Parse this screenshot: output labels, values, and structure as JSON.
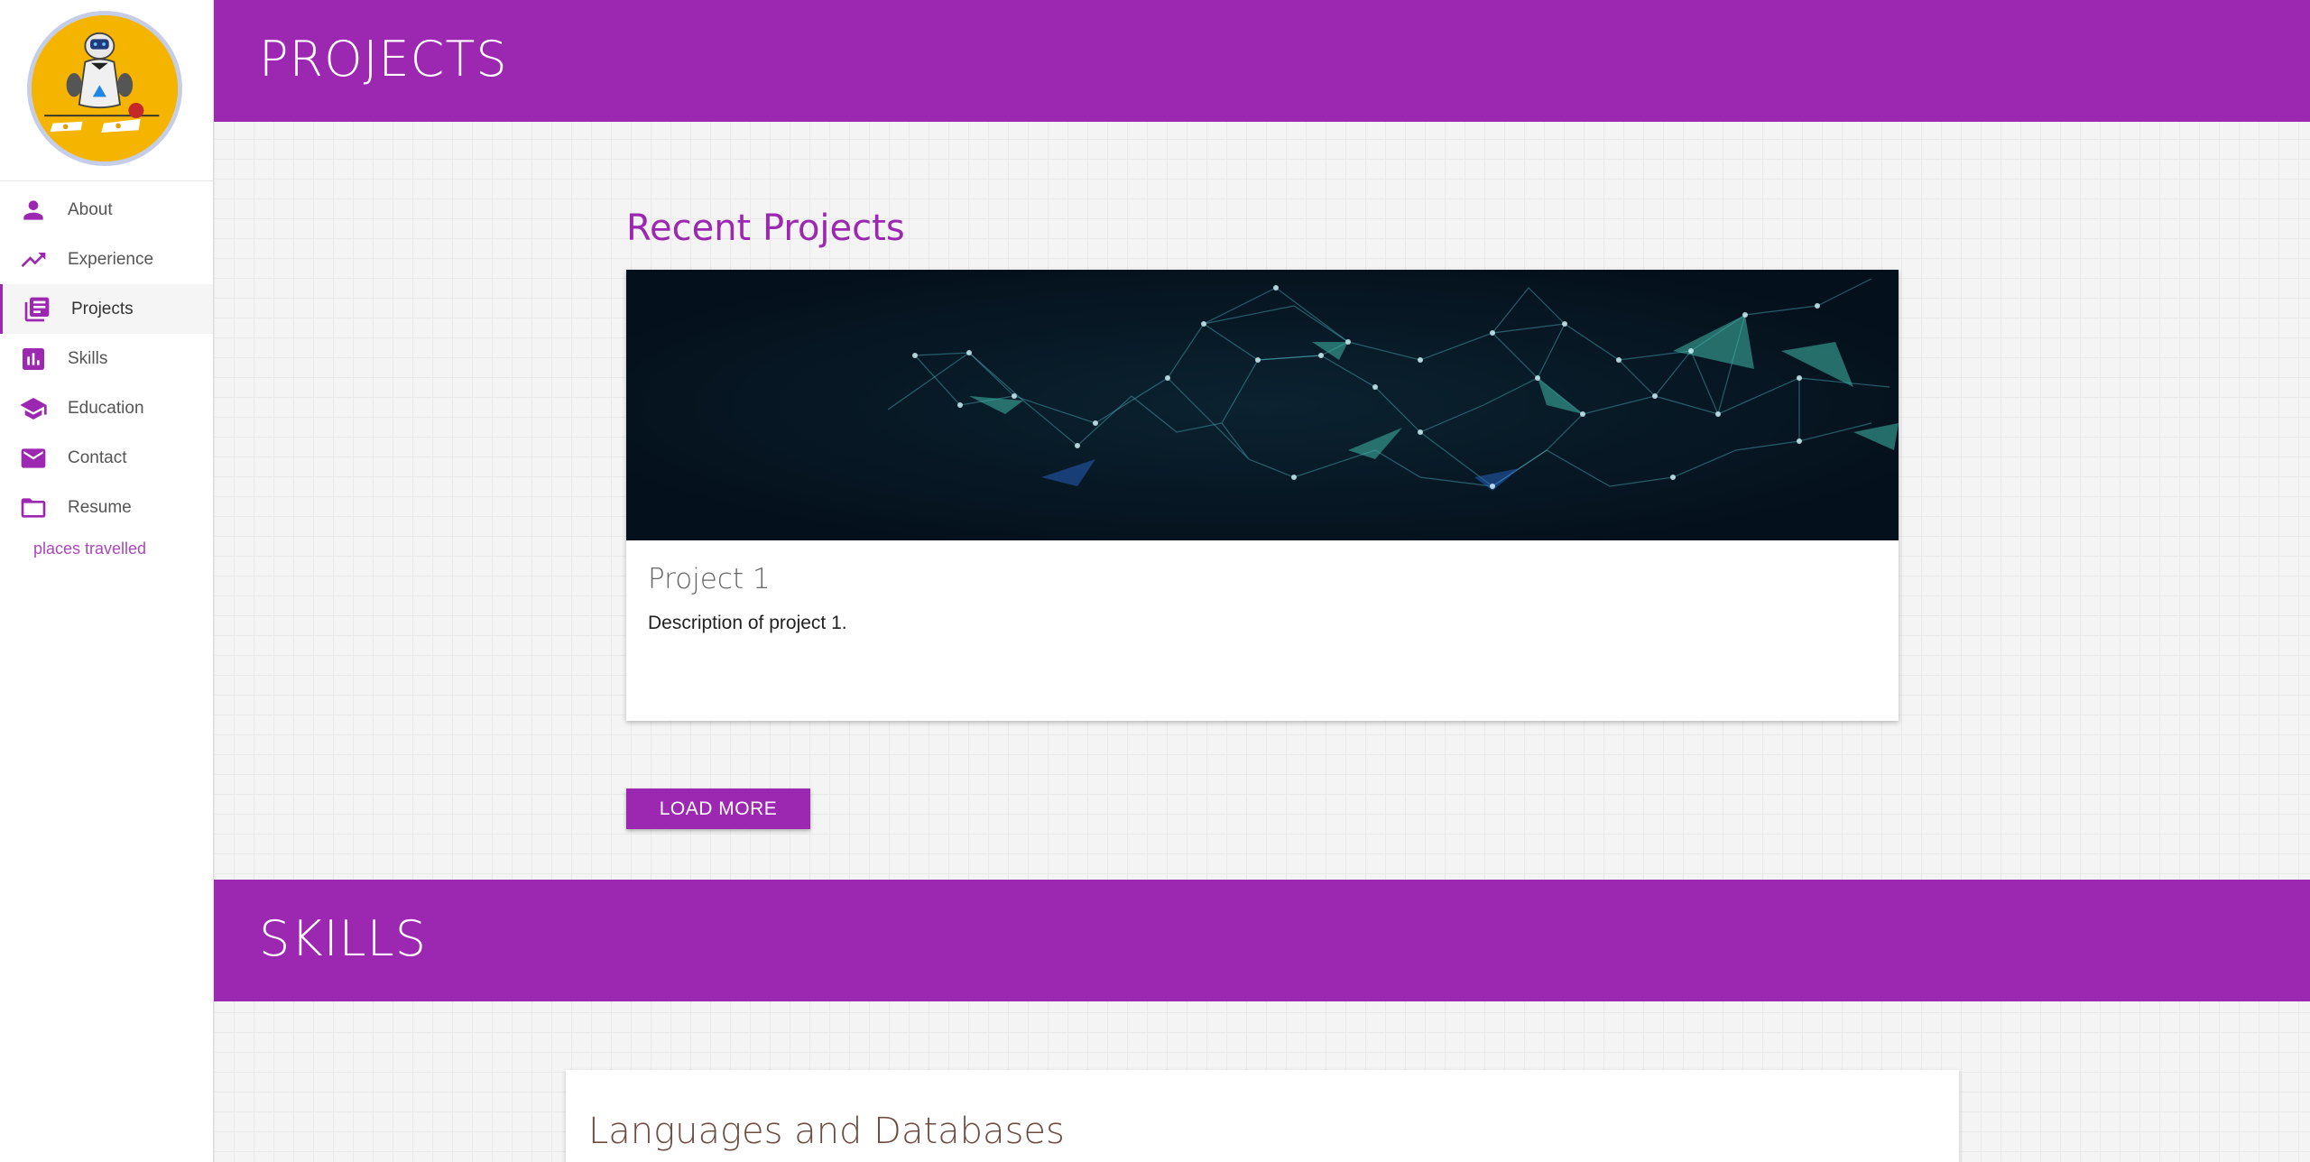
{
  "sidebar": {
    "items": [
      {
        "label": "About",
        "icon": "person-icon"
      },
      {
        "label": "Experience",
        "icon": "trending-up-icon"
      },
      {
        "label": "Projects",
        "icon": "library-books-icon",
        "active": true
      },
      {
        "label": "Skills",
        "icon": "bar-chart-icon"
      },
      {
        "label": "Education",
        "icon": "school-icon"
      },
      {
        "label": "Contact",
        "icon": "mail-icon"
      },
      {
        "label": "Resume",
        "icon": "folder-icon"
      }
    ],
    "travel_link": "places travelled"
  },
  "projects": {
    "header": "PROJECTS",
    "recent_title": "Recent Projects",
    "card": {
      "title": "Project 1",
      "description": "Description of project 1.",
      "image_icon": "network-graph-image"
    },
    "load_more": "LOAD MORE"
  },
  "skills": {
    "header": "SKILLS",
    "card_title": "Languages and Databases"
  },
  "colors": {
    "accent": "#9c27b0",
    "background": "#f4f4f4",
    "avatar_bg": "#f4b400",
    "skill_title": "#6d4c41"
  }
}
